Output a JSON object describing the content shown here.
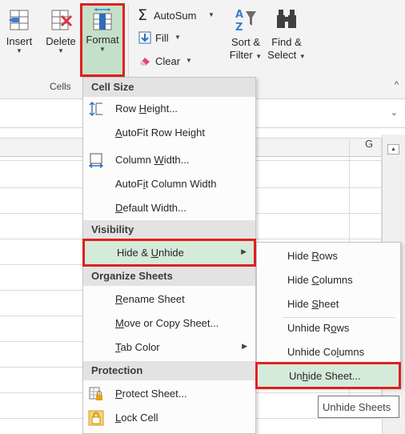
{
  "ribbon": {
    "insert_label": "Insert",
    "delete_label": "Delete",
    "format_label": "Format",
    "cells_group_label": "Cells",
    "autosum_label": "AutoSum",
    "fill_label": "Fill",
    "clear_label": "Clear",
    "sort_filter_label_1": "Sort &",
    "sort_filter_label_2": "Filter",
    "find_select_label_1": "Find &",
    "find_select_label_2": "Select"
  },
  "sheet": {
    "column_g": "G"
  },
  "menu": {
    "cell_size_header": "Cell Size",
    "row_height_pre": "Row ",
    "row_height_u": "H",
    "row_height_post": "eight...",
    "autofit_row_u": "A",
    "autofit_row_post": "utoFit Row Height",
    "column_width_pre": "Column ",
    "column_width_u": "W",
    "column_width_post": "idth...",
    "autofit_col_pre": "AutoF",
    "autofit_col_u": "i",
    "autofit_col_post": "t Column Width",
    "default_width_u": "D",
    "default_width_post": "efault Width...",
    "visibility_header": "Visibility",
    "hide_unhide_pre": "Hide & ",
    "hide_unhide_u": "U",
    "hide_unhide_post": "nhide",
    "organize_header": "Organize Sheets",
    "rename_u": "R",
    "rename_post": "ename Sheet",
    "move_copy_u": "M",
    "move_copy_post": "ove or Copy Sheet...",
    "tab_color_u": "T",
    "tab_color_post": "ab Color",
    "protection_header": "Protection",
    "protect_u": "P",
    "protect_post": "rotect Sheet...",
    "lock_u": "L",
    "lock_post": "ock Cell"
  },
  "submenu": {
    "hide_rows_pre": "Hide ",
    "hide_rows_u": "R",
    "hide_rows_post": "ows",
    "hide_columns_pre": "Hide ",
    "hide_columns_u": "C",
    "hide_columns_post": "olumns",
    "hide_sheet_pre": "Hide ",
    "hide_sheet_u": "S",
    "hide_sheet_post": "heet",
    "unhide_rows_pre": "Unhide R",
    "unhide_rows_u": "o",
    "unhide_rows_post": "ws",
    "unhide_columns_pre": "Unhide Co",
    "unhide_columns_u": "l",
    "unhide_columns_post": "umns",
    "unhide_sheet_pre": "Un",
    "unhide_sheet_u": "h",
    "unhide_sheet_post": "ide Sheet..."
  },
  "tooltip": {
    "text": "Unhide Sheets"
  },
  "colors": {
    "highlight": "#d5ebd9",
    "callout_red": "#e02020",
    "header_gray": "#e3e3e3"
  }
}
